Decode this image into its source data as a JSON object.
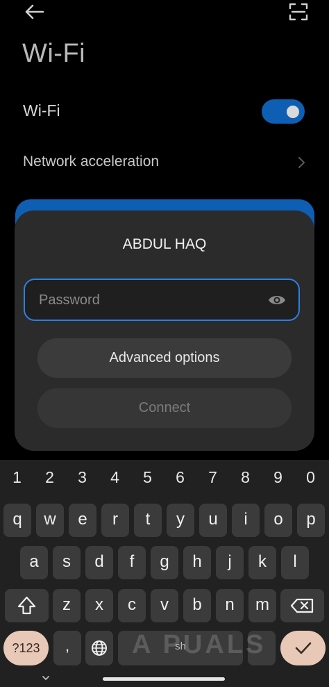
{
  "header": {
    "title": "Wi-Fi"
  },
  "settings": {
    "wifi_label": "Wi-Fi",
    "wifi_enabled": true,
    "network_acceleration_label": "Network acceleration"
  },
  "dialog": {
    "network_name": "ABDUL HAQ",
    "password_placeholder": "Password",
    "password_value": "",
    "advanced_options_label": "Advanced options",
    "connect_label": "Connect"
  },
  "keyboard": {
    "numbers": [
      "1",
      "2",
      "3",
      "4",
      "5",
      "6",
      "7",
      "8",
      "9",
      "0"
    ],
    "row1": [
      "q",
      "w",
      "e",
      "r",
      "t",
      "y",
      "u",
      "i",
      "o",
      "p"
    ],
    "row2": [
      "a",
      "s",
      "d",
      "f",
      "g",
      "h",
      "j",
      "k",
      "l"
    ],
    "row3": [
      "z",
      "x",
      "c",
      "v",
      "b",
      "n",
      "m"
    ],
    "symbols_label": "?123",
    "comma_label": ",",
    "space_label": "sh"
  },
  "watermark": "A PUALS",
  "colors": {
    "accent": "#0e5fb3",
    "focus_border": "#2c80e0",
    "dialog_bg": "#2b2b2b",
    "keyboard_bg": "#212121",
    "action_key": "#e8c9b8"
  },
  "icons": {
    "back": "back-arrow-icon",
    "scan": "qr-scan-icon",
    "chevron": "chevron-right-icon",
    "eye": "eye-icon",
    "shift": "shift-icon",
    "backspace": "backspace-icon",
    "globe": "globe-icon",
    "enter": "checkmark-icon"
  }
}
